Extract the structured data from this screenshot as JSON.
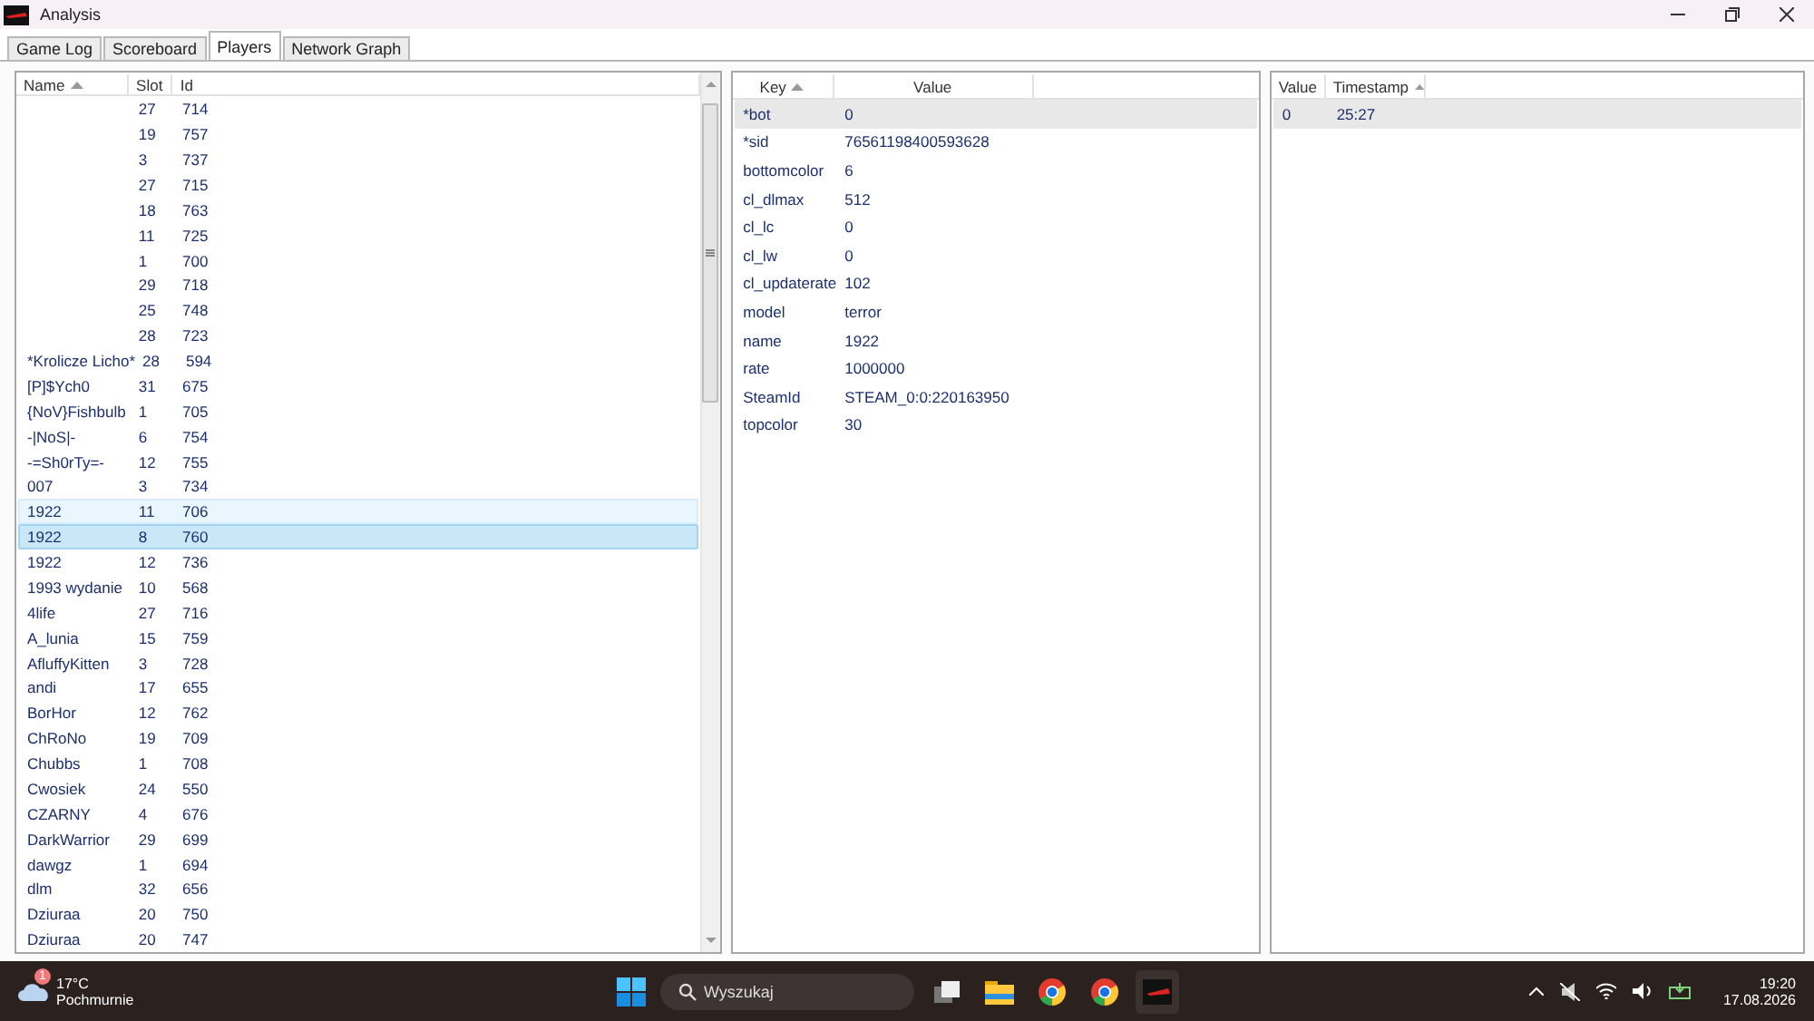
{
  "window": {
    "title": "Analysis"
  },
  "tabs": [
    {
      "label": "Game Log",
      "selected": false
    },
    {
      "label": "Scoreboard",
      "selected": false
    },
    {
      "label": "Players",
      "selected": true
    },
    {
      "label": "Network Graph",
      "selected": false
    }
  ],
  "players": {
    "columns": [
      {
        "label": "Name",
        "sorted": true
      },
      {
        "label": "Slot",
        "sorted": false
      },
      {
        "label": "Id",
        "sorted": false
      }
    ],
    "rows": [
      {
        "cells": [
          "",
          "27",
          "714"
        ],
        "selected": false,
        "hovered": false
      },
      {
        "cells": [
          "",
          "19",
          "757"
        ],
        "selected": false,
        "hovered": false
      },
      {
        "cells": [
          "",
          "3",
          "737"
        ],
        "selected": false,
        "hovered": false
      },
      {
        "cells": [
          "",
          "27",
          "715"
        ],
        "selected": false,
        "hovered": false
      },
      {
        "cells": [
          "",
          "18",
          "763"
        ],
        "selected": false,
        "hovered": false
      },
      {
        "cells": [
          "",
          "11",
          "725"
        ],
        "selected": false,
        "hovered": false
      },
      {
        "cells": [
          "",
          "1",
          "700"
        ],
        "selected": false,
        "hovered": false
      },
      {
        "cells": [
          "",
          "29",
          "718"
        ],
        "selected": false,
        "hovered": false
      },
      {
        "cells": [
          "",
          "25",
          "748"
        ],
        "selected": false,
        "hovered": false
      },
      {
        "cells": [
          "",
          "28",
          "723"
        ],
        "selected": false,
        "hovered": false
      },
      {
        "cells": [
          "*Krolicze Licho*",
          "28",
          "594"
        ],
        "selected": false,
        "hovered": false
      },
      {
        "cells": [
          "[P]$Ych0",
          "31",
          "675"
        ],
        "selected": false,
        "hovered": false
      },
      {
        "cells": [
          "{NoV}Fishbulb",
          "1",
          "705"
        ],
        "selected": false,
        "hovered": false
      },
      {
        "cells": [
          "-|NoS|-",
          "6",
          "754"
        ],
        "selected": false,
        "hovered": false
      },
      {
        "cells": [
          "-=Sh0rTy=-",
          "12",
          "755"
        ],
        "selected": false,
        "hovered": false
      },
      {
        "cells": [
          "007",
          "3",
          "734"
        ],
        "selected": false,
        "hovered": false
      },
      {
        "cells": [
          "1922",
          "11",
          "706"
        ],
        "selected": false,
        "hovered": true
      },
      {
        "cells": [
          "1922",
          "8",
          "760"
        ],
        "selected": true,
        "hovered": false
      },
      {
        "cells": [
          "1922",
          "12",
          "736"
        ],
        "selected": false,
        "hovered": false
      },
      {
        "cells": [
          "1993 wydanie",
          "10",
          "568"
        ],
        "selected": false,
        "hovered": false
      },
      {
        "cells": [
          "4life",
          "27",
          "716"
        ],
        "selected": false,
        "hovered": false
      },
      {
        "cells": [
          "A_lunia",
          "15",
          "759"
        ],
        "selected": false,
        "hovered": false
      },
      {
        "cells": [
          "AfluffyKitten",
          "3",
          "728"
        ],
        "selected": false,
        "hovered": false
      },
      {
        "cells": [
          "andi",
          "17",
          "655"
        ],
        "selected": false,
        "hovered": false
      },
      {
        "cells": [
          "BorHor",
          "12",
          "762"
        ],
        "selected": false,
        "hovered": false
      },
      {
        "cells": [
          "ChRoNo",
          "19",
          "709"
        ],
        "selected": false,
        "hovered": false
      },
      {
        "cells": [
          "Chubbs",
          "1",
          "708"
        ],
        "selected": false,
        "hovered": false
      },
      {
        "cells": [
          "Cwosiek",
          "24",
          "550"
        ],
        "selected": false,
        "hovered": false
      },
      {
        "cells": [
          "CZARNY",
          "4",
          "676"
        ],
        "selected": false,
        "hovered": false
      },
      {
        "cells": [
          "DarkWarrior",
          "29",
          "699"
        ],
        "selected": false,
        "hovered": false
      },
      {
        "cells": [
          "dawgz",
          "1",
          "694"
        ],
        "selected": false,
        "hovered": false
      },
      {
        "cells": [
          "dlm",
          "32",
          "656"
        ],
        "selected": false,
        "hovered": false
      },
      {
        "cells": [
          "Dziuraa",
          "20",
          "750"
        ],
        "selected": false,
        "hovered": false
      },
      {
        "cells": [
          "Dziuraa",
          "20",
          "747"
        ],
        "selected": false,
        "hovered": false
      }
    ]
  },
  "properties": {
    "columns": [
      {
        "label": "Key",
        "sorted": true
      },
      {
        "label": "Value",
        "sorted": false
      }
    ],
    "rows": [
      {
        "cells": [
          "*bot",
          "0"
        ],
        "selected": true
      },
      {
        "cells": [
          "*sid",
          "76561198400593628"
        ],
        "selected": false
      },
      {
        "cells": [
          "bottomcolor",
          "6"
        ],
        "selected": false
      },
      {
        "cells": [
          "cl_dlmax",
          "512"
        ],
        "selected": false
      },
      {
        "cells": [
          "cl_lc",
          "0"
        ],
        "selected": false
      },
      {
        "cells": [
          "cl_lw",
          "0"
        ],
        "selected": false
      },
      {
        "cells": [
          "cl_updaterate",
          "102"
        ],
        "selected": false
      },
      {
        "cells": [
          "model",
          "terror"
        ],
        "selected": false
      },
      {
        "cells": [
          "name",
          "1922"
        ],
        "selected": false
      },
      {
        "cells": [
          "rate",
          "1000000"
        ],
        "selected": false
      },
      {
        "cells": [
          "SteamId",
          "STEAM_0:0:220163950"
        ],
        "selected": false
      },
      {
        "cells": [
          "topcolor",
          "30"
        ],
        "selected": false
      }
    ]
  },
  "history": {
    "columns": [
      {
        "label": "Value",
        "sorted": false
      },
      {
        "label": "Timestamp",
        "sorted": true
      }
    ],
    "rows": [
      {
        "cells": [
          "0",
          "25:27"
        ],
        "selected": true
      }
    ]
  },
  "taskbar": {
    "weather": {
      "badge": "1",
      "temperature": "17°C",
      "condition": "Pochmurnie"
    },
    "search": {
      "placeholder": "Wyszukaj"
    },
    "time": "19:20",
    "date": "17.08.2026"
  }
}
